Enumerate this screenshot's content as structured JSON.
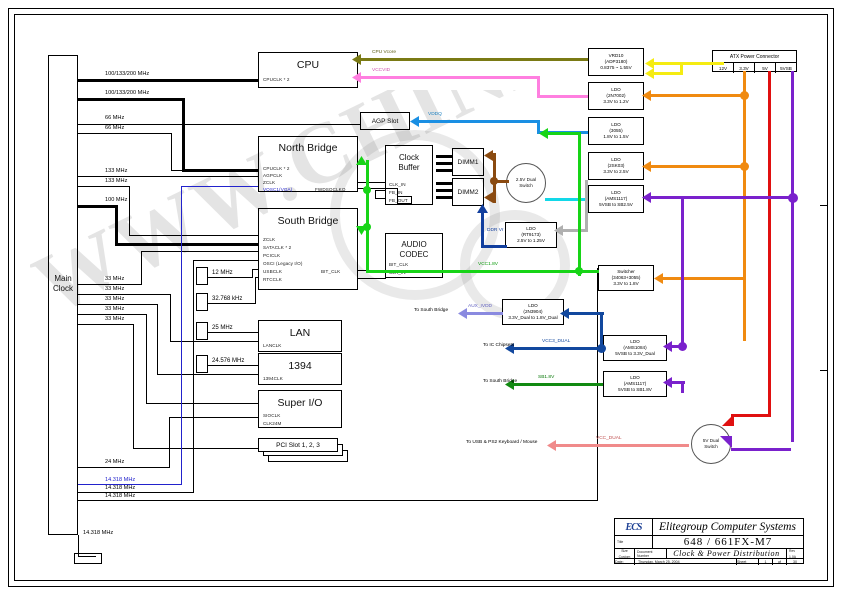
{
  "sheet": {
    "watermark": "WWW.CHINAFIX.COM.CN"
  },
  "title_block": {
    "company": "Elitegroup Computer Systems",
    "logo": "ECS",
    "board_model": "648 / 661FX-M7",
    "drawing_title": "Clock & Power Distribution",
    "label_title": "Title",
    "label_size": "Size",
    "label_doc": "Document Number",
    "label_rev": "Rev",
    "size_value": "Custom",
    "rev_value": "1.0A",
    "label_date": "Date:",
    "date_value": "Thursday, March 25, 2004",
    "label_sheet": "Sheet",
    "sheet_of": "of",
    "sheet_num": "1",
    "sheet_total": "30"
  },
  "clock_source": {
    "name": "Main Clock",
    "outputs": [
      "100/133/200 MHz",
      "100/133/200 MHz",
      "66 MHz",
      "66 MHz",
      "133 MHz",
      "133 MHz",
      "100 MHz",
      "33 MHz",
      "33 MHz",
      "33 MHz",
      "33 MHz",
      "33 MHz",
      "24 MHz",
      "14.318 MHz",
      "14.318 MHz",
      "14.318 MHz"
    ],
    "xtal_out": "14.318 MHz"
  },
  "crystals": [
    {
      "label": "12 MHz"
    },
    {
      "label": "32.768 kHz"
    },
    {
      "label": "25 MHz"
    },
    {
      "label": "24.576 MHz"
    }
  ],
  "blocks": {
    "cpu": {
      "title": "CPU",
      "pins": [
        "CPUCLK * 2"
      ]
    },
    "agp": {
      "title": "AGP Slot",
      "pins": []
    },
    "north_bridge": {
      "title": "North Bridge",
      "pins": [
        "CPUCLK * 2",
        "AGPCLK",
        "ZCLK"
      ],
      "pin_blue": "VOSC1(VGA)",
      "pin_right": "FWDSOCLKO"
    },
    "south_bridge": {
      "title": "South Bridge",
      "pins": [
        "ZCLK",
        "SATACLK * 2",
        "PCICLK",
        "OSCI (Legacy I/O)",
        "USBCLK",
        "RTCCLK"
      ],
      "pin_right": "BIT_CLK"
    },
    "clock_buffer": {
      "title_line1": "Clock",
      "title_line2": "Buffer",
      "pins": [
        "CLK_IN",
        "FB_IN",
        "FB_OUT"
      ]
    },
    "audio_codec": {
      "title_line1": "AUDIO",
      "title_line2": "CODEC",
      "pins": [
        "BIT_CLK",
        "CLK_IN"
      ]
    },
    "dimm1": {
      "title": "DIMM1"
    },
    "dimm2": {
      "title": "DIMM2"
    },
    "lan": {
      "title": "LAN",
      "pins": [
        "LANCLK"
      ]
    },
    "ieee1394": {
      "title": "1394",
      "pins": [
        "1394CLK"
      ]
    },
    "super_io": {
      "title": "Super I/O",
      "pins": [
        "SIOCLK",
        "CLK24M"
      ]
    },
    "pci_slots": {
      "title": "PCI Slot 1, 2, 3"
    }
  },
  "atx_connector": {
    "title": "ATX Power Connector",
    "rails": [
      "12V",
      "3.3V",
      "5V",
      "5VSB"
    ]
  },
  "power_blocks": [
    {
      "id": "vrd10",
      "l1": "VRD10",
      "l2": "(ADP3180)",
      "l3": "0.8375 ~ 1.55V"
    },
    {
      "id": "ldo_2n7002",
      "l1": "LDO",
      "l2": "(2N7002)",
      "l3": "3.3V to 1.2V"
    },
    {
      "id": "ldo_3055",
      "l1": "LDO",
      "l2": "(3055)",
      "l3": "1.8V to 1.5V"
    },
    {
      "id": "ldo_2sk03",
      "l1": "LDO",
      "l2": "(2SK03)",
      "l3": "3.3V to 2.5V"
    },
    {
      "id": "ldo_ams1117_sb",
      "l1": "LDO",
      "l2": "(AMS1117)",
      "l3": "5VSB to SB2.5V"
    },
    {
      "id": "ldo_rt9173",
      "l1": "LDO",
      "l2": "(RT9173)",
      "l3": "2.5V to 1.25V"
    },
    {
      "id": "switcher",
      "l1": "Switcher",
      "l2": "(34063+3055)",
      "l3": "3.3V to 1.8V"
    },
    {
      "id": "ldo_2n3904",
      "l1": "LDO",
      "l2": "(2N3904)",
      "l3": "3.3V_Dual to 1.8V_Dual"
    },
    {
      "id": "ldo_ams1084",
      "l1": "LDO",
      "l2": "(AMS1084)",
      "l3": "5VSB to 3.3V_Dual"
    },
    {
      "id": "ldo_ams1117_sb18",
      "l1": "LDO",
      "l2": "(AMS1117)",
      "l3": "5VSB to SB1.8V"
    }
  ],
  "switches": [
    {
      "id": "sw25",
      "l1": "2.5V Dual",
      "l2": "Switch"
    },
    {
      "id": "sw5",
      "l1": "5V Dual",
      "l2": "Switch"
    }
  ],
  "net_labels": {
    "cpu_vcore": "CPU Vcore",
    "vccvid": "VCCVID",
    "vddq": "VDDQ",
    "ddr_vref": "DDR Vr",
    "vcc1_8v": "VCC1.8V",
    "aux_ivdd": "AUX_IVDD",
    "vcc3_dual": "VCC3_DUAL",
    "sb1_8v": "SB1.8V",
    "vcc_dual": "VCC_DUAL",
    "to_south_bridge_a": "To South Bridge",
    "to_ic_chipsets": "To IC Chipsets",
    "to_south_bridge_b": "To South Bridge",
    "to_usb_ps2": "To USB & PS2 Keyboard / Mouse"
  },
  "colors": {
    "cpu_vcore": "#7a7a14",
    "vccvid": "#ff7fe0",
    "vddq": "#1a8fe3",
    "ddr_vref": "#123f9e",
    "green": "#17d417",
    "orange": "#f08a10",
    "purple": "#7a21cc",
    "yellow": "#f5ec12",
    "red": "#e01010",
    "brown": "#8a4a10",
    "cyan": "#12d8e8",
    "gray": "#b0b0b0",
    "navy": "#12489e",
    "darkgreen": "#128a12",
    "salmon": "#f08a8a",
    "violet": "#8a8ae0",
    "blue_text": "#2222cc"
  }
}
